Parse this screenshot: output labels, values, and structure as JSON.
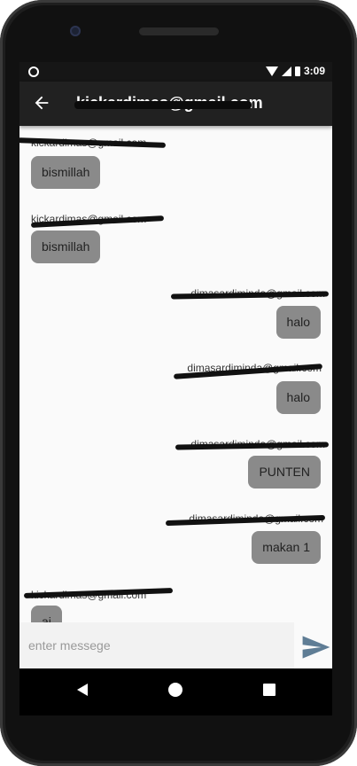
{
  "status_bar": {
    "time": "3:09"
  },
  "app_bar": {
    "title": "kickardimas@gmail.com"
  },
  "messages": [
    {
      "sender": "kickardimas@gmail.com",
      "text": "bismillah",
      "side": "left"
    },
    {
      "sender": "kickardimas@gmail.com",
      "text": "bismillah",
      "side": "left"
    },
    {
      "sender": "dimasardiminda@gmail.com",
      "text": "halo",
      "side": "right"
    },
    {
      "sender": "dimasardiminda@gmail.com",
      "text": "halo",
      "side": "right"
    },
    {
      "sender": "dimasardiminda@gmail.com",
      "text": "PUNTEN",
      "side": "right"
    },
    {
      "sender": "dimasardiminda@gmail.com",
      "text": "makan 1",
      "side": "right"
    },
    {
      "sender": "kickardimas@gmail.com",
      "text": "ai",
      "side": "left"
    }
  ],
  "composer": {
    "placeholder": "enter messege",
    "value": ""
  },
  "colors": {
    "bubble": "#8a8a8a",
    "app_bar": "#212121",
    "send_icon": "#5f7d95"
  }
}
